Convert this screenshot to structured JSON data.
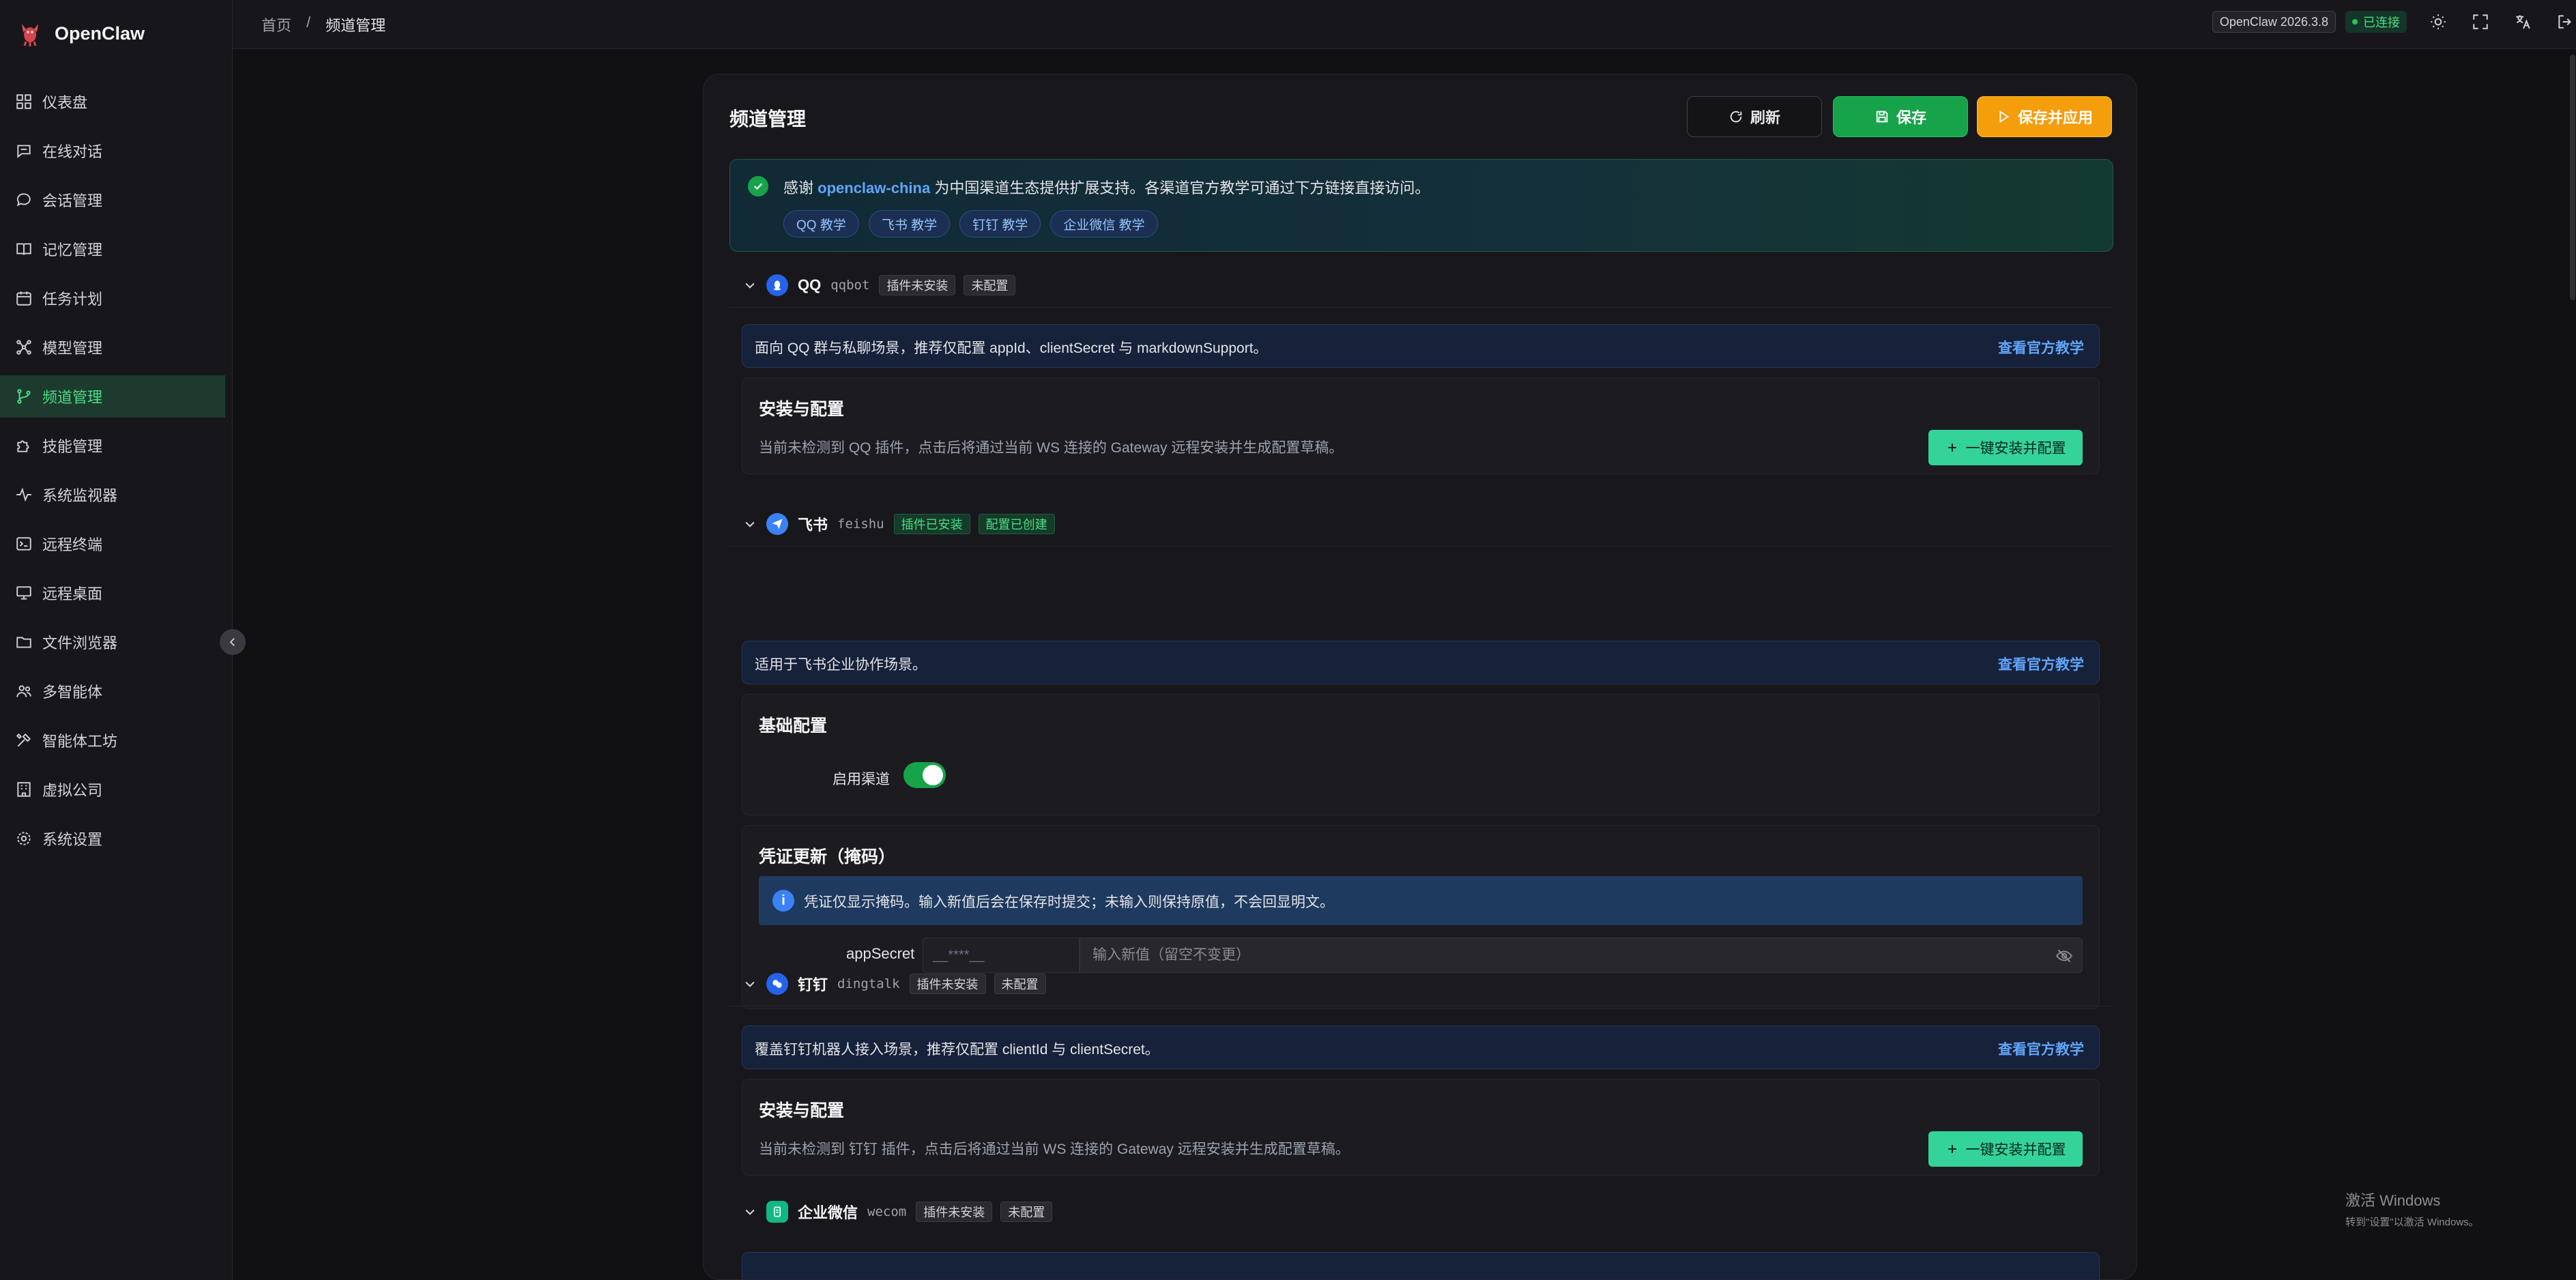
{
  "app": {
    "name": "OpenClaw"
  },
  "sidebar": {
    "items": [
      {
        "label": "仪表盘",
        "icon": "dashboard-icon"
      },
      {
        "label": "在线对话",
        "icon": "chat-icon"
      },
      {
        "label": "会话管理",
        "icon": "conversation-icon"
      },
      {
        "label": "记忆管理",
        "icon": "book-icon"
      },
      {
        "label": "任务计划",
        "icon": "calendar-icon"
      },
      {
        "label": "模型管理",
        "icon": "model-icon"
      },
      {
        "label": "频道管理",
        "icon": "channel-icon",
        "active": true
      },
      {
        "label": "技能管理",
        "icon": "puzzle-icon"
      },
      {
        "label": "系统监视器",
        "icon": "pulse-icon"
      },
      {
        "label": "远程终端",
        "icon": "terminal-icon"
      },
      {
        "label": "远程桌面",
        "icon": "monitor-icon"
      },
      {
        "label": "文件浏览器",
        "icon": "folder-icon"
      },
      {
        "label": "多智能体",
        "icon": "users-icon"
      },
      {
        "label": "智能体工坊",
        "icon": "tools-icon"
      },
      {
        "label": "虚拟公司",
        "icon": "building-icon"
      },
      {
        "label": "系统设置",
        "icon": "gear-icon"
      }
    ]
  },
  "header": {
    "breadcrumb_home": "首页",
    "breadcrumb_sep": "/",
    "breadcrumb_current": "频道管理",
    "version": "OpenClaw 2026.3.8",
    "status": "已连接"
  },
  "page": {
    "title": "频道管理",
    "refresh_label": "刷新",
    "save_label": "保存",
    "apply_label": "保存并应用"
  },
  "notice": {
    "prefix": "感谢",
    "highlight": "openclaw-china",
    "suffix": "为中国渠道生态提供扩展支持。各渠道官方教学可通过下方链接直接访问。",
    "chips": [
      "QQ 教学",
      "飞书 教学",
      "钉钉 教学",
      "企业微信 教学"
    ]
  },
  "channels": {
    "qq": {
      "name": "QQ",
      "code": "qqbot",
      "badge1": "插件未安装",
      "badge2": "未配置",
      "desc": "面向 QQ 群与私聊场景，推荐仅配置 appId、clientSecret 与 markdownSupport。",
      "link": "查看官方教学",
      "card_title": "安装与配置",
      "card_hint": "当前未检测到 QQ 插件，点击后将通过当前 WS 连接的 Gateway 远程安装并生成配置草稿。",
      "install_label": "一键安装并配置"
    },
    "feishu": {
      "name": "飞书",
      "code": "feishu",
      "badge1": "插件已安装",
      "badge2": "配置已创建",
      "desc": "适用于飞书企业协作场景。",
      "link": "查看官方教学",
      "basic_title": "基础配置",
      "enable_label": "启用渠道",
      "enabled": true,
      "cred_title": "凭证更新（掩码）",
      "cred_info": "凭证仅显示掩码。输入新值后会在保存时提交；未输入则保持原值，不会回显明文。",
      "field_label": "appSecret",
      "masked_value": "__****__",
      "input_placeholder": "输入新值（留空不变更）"
    },
    "dingtalk": {
      "name": "钉钉",
      "code": "dingtalk",
      "badge1": "插件未安装",
      "badge2": "未配置",
      "desc": "覆盖钉钉机器人接入场景，推荐仅配置 clientId 与 clientSecret。",
      "link": "查看官方教学",
      "card_title": "安装与配置",
      "card_hint": "当前未检测到 钉钉 插件，点击后将通过当前 WS 连接的 Gateway 远程安装并生成配置草稿。",
      "install_label": "一键安装并配置"
    },
    "wecom": {
      "name": "企业微信",
      "code": "wecom",
      "badge1": "插件未安装",
      "badge2": "未配置"
    }
  },
  "watermark": {
    "line1": "激活 Windows",
    "line2": "转到\"设置\"以激活 Windows。"
  }
}
